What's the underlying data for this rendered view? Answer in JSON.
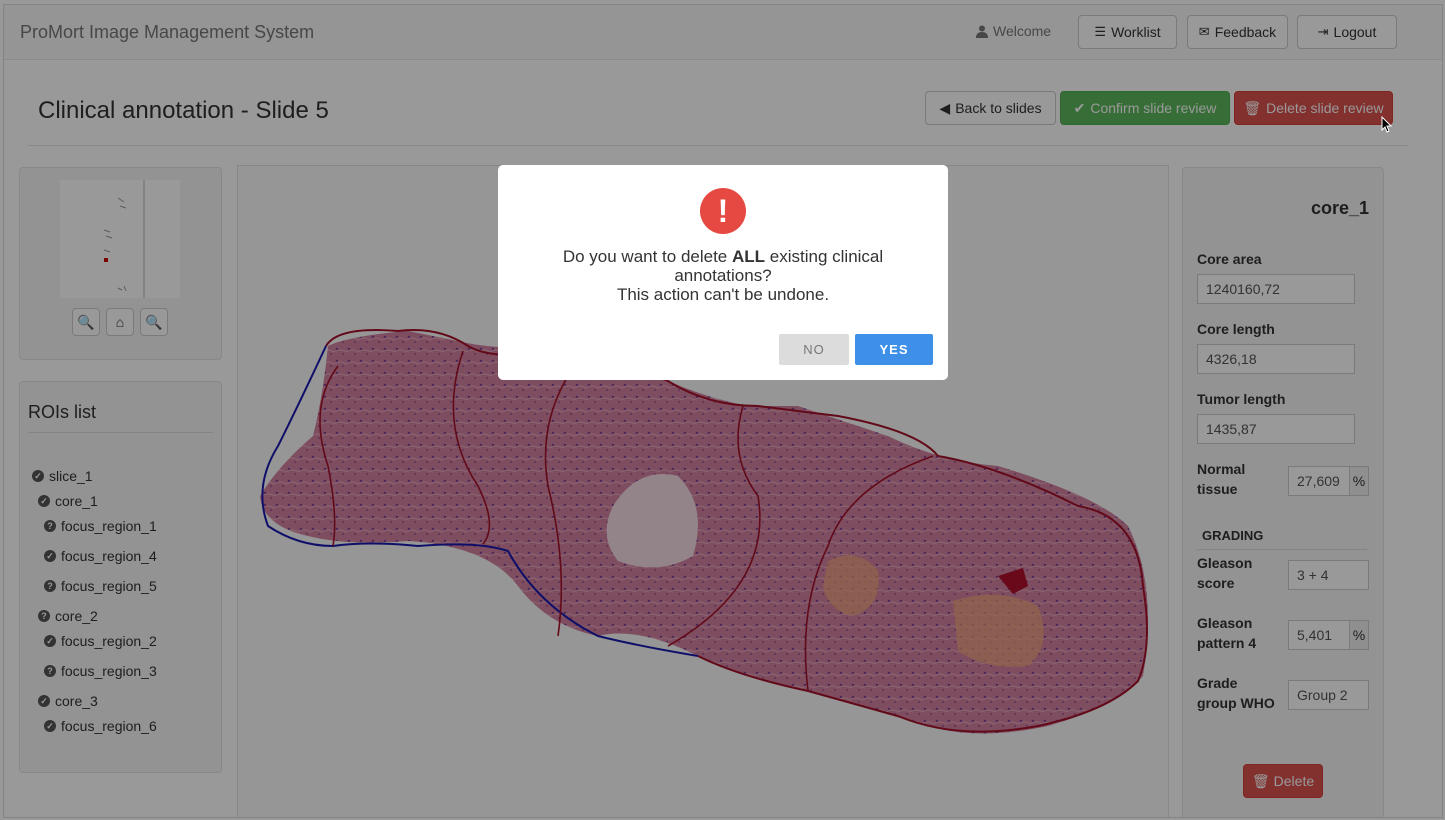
{
  "navbar": {
    "brand": "ProMort Image Management System",
    "welcome": "Welcome",
    "worklist": "Worklist",
    "feedback": "Feedback",
    "logout": "Logout"
  },
  "page": {
    "title": "Clinical annotation - Slide 5",
    "back_button": "Back to slides",
    "confirm_button": "Confirm slide review",
    "delete_button": "Delete slide review"
  },
  "rois": {
    "title": "ROIs list",
    "items": [
      {
        "label": "slice_1",
        "status": "check"
      },
      {
        "label": "core_1",
        "status": "check"
      },
      {
        "label": "focus_region_1",
        "status": "question"
      },
      {
        "label": "focus_region_4",
        "status": "check"
      },
      {
        "label": "focus_region_5",
        "status": "question"
      },
      {
        "label": "core_2",
        "status": "question"
      },
      {
        "label": "focus_region_2",
        "status": "check"
      },
      {
        "label": "focus_region_3",
        "status": "question"
      },
      {
        "label": "core_3",
        "status": "check"
      },
      {
        "label": "focus_region_6",
        "status": "check"
      }
    ]
  },
  "details": {
    "title": "core_1",
    "core_area_label": "Core area",
    "core_area": "1240160,72",
    "core_length_label": "Core length",
    "core_length": "4326,18",
    "tumor_length_label": "Tumor length",
    "tumor_length": "1435,87",
    "normal_tissue_label_1": "Normal",
    "normal_tissue_label_2": "tissue",
    "normal_tissue": "27,609",
    "percent": "%",
    "grading_label": "GRADING",
    "gleason_score_label_1": "Gleason",
    "gleason_score_label_2": "score",
    "gleason_score": "3 + 4",
    "gleason_p4_label_1": "Gleason",
    "gleason_p4_label_2": "pattern 4",
    "gleason_p4": "5,401",
    "grade_group_label_1": "Grade",
    "grade_group_label_2": "group WHO",
    "grade_group": "Group 2",
    "delete_button": "Delete"
  },
  "modal": {
    "line1_pre": "Do you want to delete ",
    "line1_bold": "ALL",
    "line1_post": " existing clinical",
    "line2": "annotations?",
    "line3": "This action can't be undone.",
    "no": "NO",
    "yes": "YES"
  },
  "colors": {
    "danger": "#d9534f",
    "success": "#5cb85c",
    "primary": "#3d8fe8",
    "roi_blue": "#1a1ab0",
    "roi_red": "#a3122a"
  }
}
